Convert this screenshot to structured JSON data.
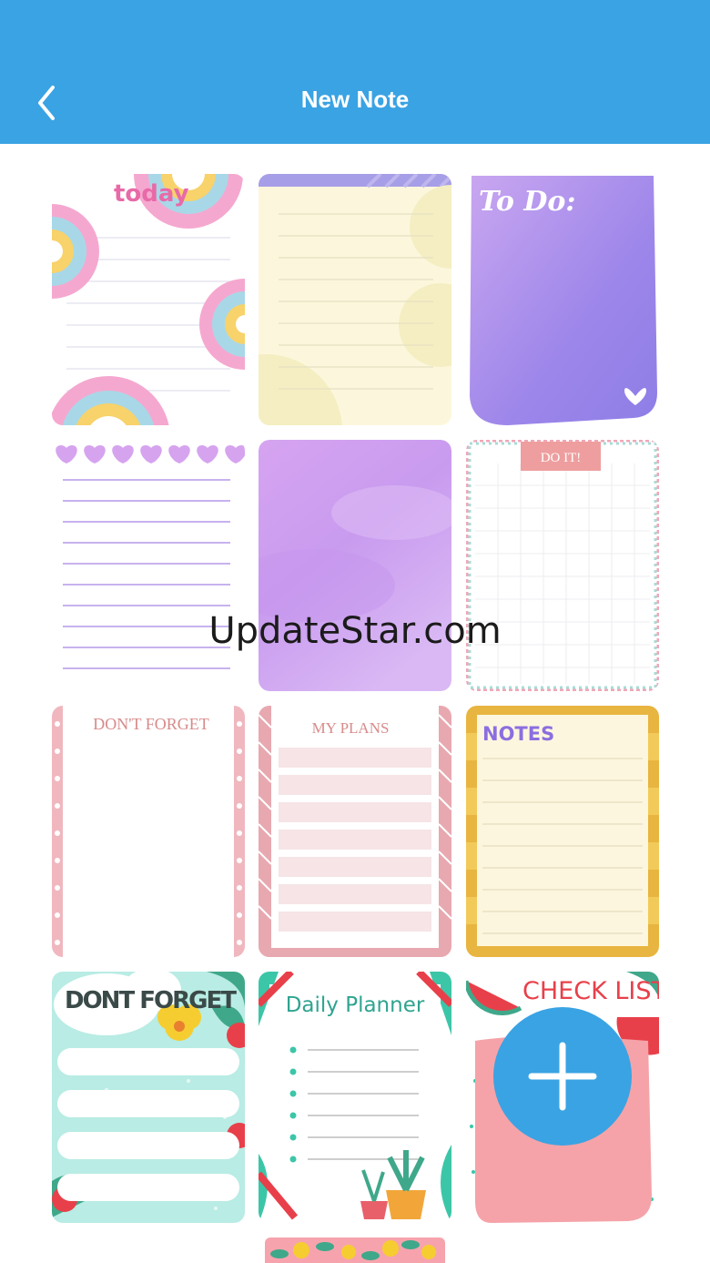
{
  "header": {
    "title": "New Note",
    "back_icon": "chevron-left-icon",
    "background": "#3aa3e3"
  },
  "templates": [
    {
      "id": "today",
      "text": "today"
    },
    {
      "id": "cream-lined",
      "text": ""
    },
    {
      "id": "todo",
      "text": "To Do:"
    },
    {
      "id": "hearts-lined",
      "text": ""
    },
    {
      "id": "purple-watercolor",
      "text": ""
    },
    {
      "id": "do-it",
      "text": "DO IT!"
    },
    {
      "id": "dont-forget",
      "text": "DON'T FORGET"
    },
    {
      "id": "my-plans",
      "text": "MY PLANS"
    },
    {
      "id": "notes",
      "text": "NOTES"
    },
    {
      "id": "dont-forget-floral",
      "text": "DONT FORGET"
    },
    {
      "id": "daily-planner",
      "text": "Daily Planner"
    },
    {
      "id": "check-list",
      "text": "CHECK LIST"
    },
    {
      "id": "floral-partial",
      "text": ""
    }
  ],
  "watermark": "UpdateStar.com",
  "fab": {
    "icon": "plus-icon"
  }
}
